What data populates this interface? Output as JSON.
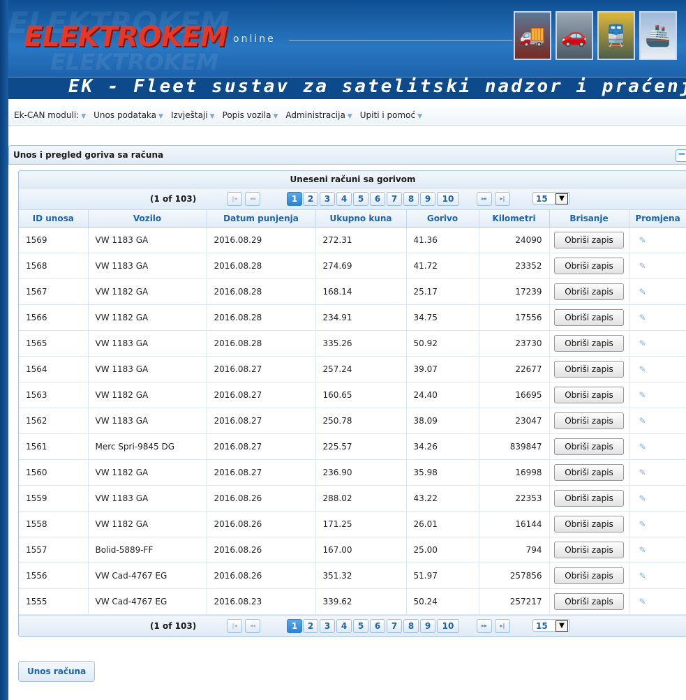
{
  "header": {
    "logo_text": "ELEKTROKEM",
    "logo_suffix": "online",
    "title": "EK - Fleet sustav za satelitski nadzor i praćenje",
    "thumbnails": [
      "truck-icon",
      "car-icon",
      "train-icon",
      "ship-icon"
    ]
  },
  "menu": {
    "items": [
      {
        "label": "Ek-CAN moduli:"
      },
      {
        "label": "Unos podataka"
      },
      {
        "label": "Izvještaji"
      },
      {
        "label": "Popis vozila"
      },
      {
        "label": "Administracija"
      },
      {
        "label": "Upiti i pomoć"
      }
    ]
  },
  "panel": {
    "title": "Unos i pregled goriva sa računa",
    "collapse_symbol": "−"
  },
  "table": {
    "caption": "Uneseni računi sa gorivom",
    "page_info": "(1 of 103)",
    "pages": [
      "1",
      "2",
      "3",
      "4",
      "5",
      "6",
      "7",
      "8",
      "9",
      "10"
    ],
    "current_page": "1",
    "nav": {
      "first": "|◂",
      "prev": "◂◂",
      "next": "▸▸",
      "last": "▸|"
    },
    "rows_per_page": "15",
    "columns": [
      "ID unosa",
      "Vozilo",
      "Datum punjenja",
      "Ukupno kuna",
      "Gorivo",
      "Kilometri",
      "Brisanje",
      "Promjena"
    ],
    "delete_label": "Obriši zapis",
    "edit_glyph": "✎",
    "rows": [
      {
        "id": "1569",
        "vozilo": "VW 1183 GA",
        "datum": "2016.08.29",
        "kuna": "272.31",
        "gorivo": "41.36",
        "km": "24090"
      },
      {
        "id": "1568",
        "vozilo": "VW 1183 GA",
        "datum": "2016.08.28",
        "kuna": "274.69",
        "gorivo": "41.72",
        "km": "23352"
      },
      {
        "id": "1567",
        "vozilo": "VW 1182 GA",
        "datum": "2016.08.28",
        "kuna": "168.14",
        "gorivo": "25.17",
        "km": "17239"
      },
      {
        "id": "1566",
        "vozilo": "VW 1182 GA",
        "datum": "2016.08.28",
        "kuna": "234.91",
        "gorivo": "34.75",
        "km": "17556"
      },
      {
        "id": "1565",
        "vozilo": "VW 1183 GA",
        "datum": "2016.08.28",
        "kuna": "335.26",
        "gorivo": "50.92",
        "km": "23730"
      },
      {
        "id": "1564",
        "vozilo": "VW 1183 GA",
        "datum": "2016.08.27",
        "kuna": "257.24",
        "gorivo": "39.07",
        "km": "22677"
      },
      {
        "id": "1563",
        "vozilo": "VW 1182 GA",
        "datum": "2016.08.27",
        "kuna": "160.65",
        "gorivo": "24.40",
        "km": "16695"
      },
      {
        "id": "1562",
        "vozilo": "VW 1183 GA",
        "datum": "2016.08.27",
        "kuna": "250.78",
        "gorivo": "38.09",
        "km": "23047"
      },
      {
        "id": "1561",
        "vozilo": "Merc Spri-9845 DG",
        "datum": "2016.08.27",
        "kuna": "225.57",
        "gorivo": "34.26",
        "km": "839847"
      },
      {
        "id": "1560",
        "vozilo": "VW 1182 GA",
        "datum": "2016.08.27",
        "kuna": "236.90",
        "gorivo": "35.98",
        "km": "16998"
      },
      {
        "id": "1559",
        "vozilo": "VW 1183 GA",
        "datum": "2016.08.26",
        "kuna": "288.02",
        "gorivo": "43.22",
        "km": "22353"
      },
      {
        "id": "1558",
        "vozilo": "VW 1182 GA",
        "datum": "2016.08.26",
        "kuna": "171.25",
        "gorivo": "26.01",
        "km": "16144"
      },
      {
        "id": "1557",
        "vozilo": "Bolid-5889-FF",
        "datum": "2016.08.26",
        "kuna": "167.00",
        "gorivo": "25.00",
        "km": "794"
      },
      {
        "id": "1556",
        "vozilo": "VW Cad-4767 EG",
        "datum": "2016.08.26",
        "kuna": "351.32",
        "gorivo": "51.97",
        "km": "257856"
      },
      {
        "id": "1555",
        "vozilo": "VW Cad-4767 EG",
        "datum": "2016.08.23",
        "kuna": "339.62",
        "gorivo": "50.24",
        "km": "257217"
      }
    ]
  },
  "footer": {
    "add_button": "Unos računa"
  },
  "colors": {
    "brand_blue": "#0c4a8c",
    "accent": "#1d63ad",
    "logo_red": "#e23a2a"
  }
}
